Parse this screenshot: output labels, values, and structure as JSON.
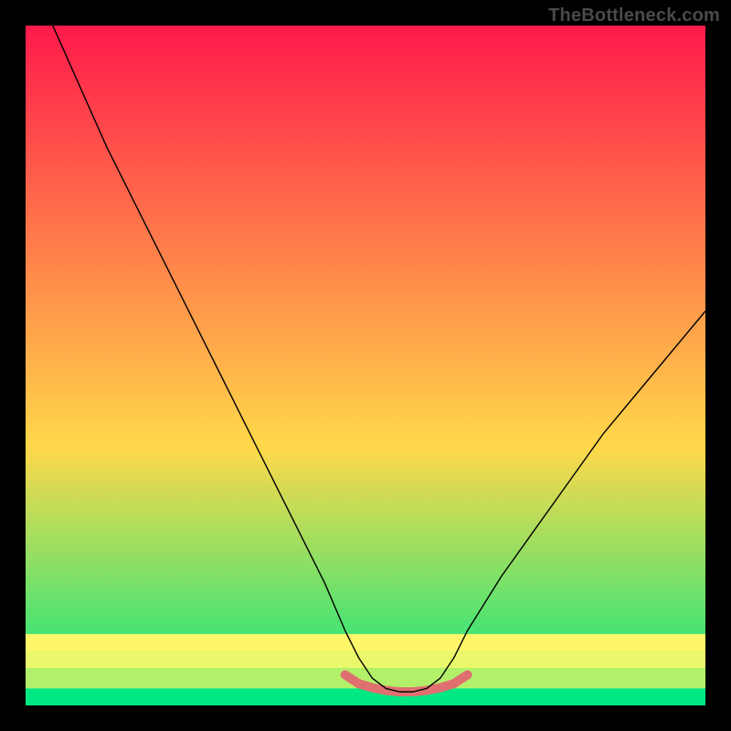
{
  "watermark": "TheBottleneck.com",
  "chart_data": {
    "type": "line",
    "title": "",
    "xlabel": "",
    "ylabel": "",
    "xlim": [
      0,
      100
    ],
    "ylim": [
      0,
      100
    ],
    "legend": false,
    "grid": false,
    "background_gradient": {
      "top_color": "#ff1a4b",
      "mid_color": "#ffd84a",
      "bottom_color": "#00e884"
    },
    "series": [
      {
        "name": "curve",
        "color": "#000000",
        "stroke_width": 1.4,
        "x": [
          4,
          8,
          12,
          16,
          20,
          24,
          28,
          32,
          36,
          40,
          44,
          47,
          49,
          51,
          53,
          55,
          57,
          59,
          61,
          63,
          65,
          70,
          75,
          80,
          85,
          90,
          95,
          100
        ],
        "y": [
          100,
          91,
          82,
          74,
          66,
          58,
          50,
          42,
          34,
          26,
          18,
          11,
          7,
          4,
          2.5,
          2,
          2,
          2.5,
          4,
          7,
          11,
          19,
          26,
          33,
          40,
          46,
          52,
          58
        ]
      },
      {
        "name": "floor-highlight",
        "color": "#e07070",
        "stroke_width": 10,
        "linecap": "round",
        "x": [
          47,
          49,
          51,
          53,
          55,
          57,
          59,
          61,
          63,
          65
        ],
        "y": [
          4.5,
          3.2,
          2.6,
          2.2,
          2.0,
          2.0,
          2.2,
          2.6,
          3.2,
          4.5
        ]
      }
    ],
    "bottom_bands": [
      {
        "y0": 0.0,
        "y1": 2.5,
        "color": "#00e884"
      },
      {
        "y0": 2.5,
        "y1": 5.5,
        "color": "#b3f06a"
      },
      {
        "y0": 5.5,
        "y1": 8.0,
        "color": "#e8f86a"
      },
      {
        "y0": 8.0,
        "y1": 10.5,
        "color": "#fff66a"
      }
    ]
  }
}
